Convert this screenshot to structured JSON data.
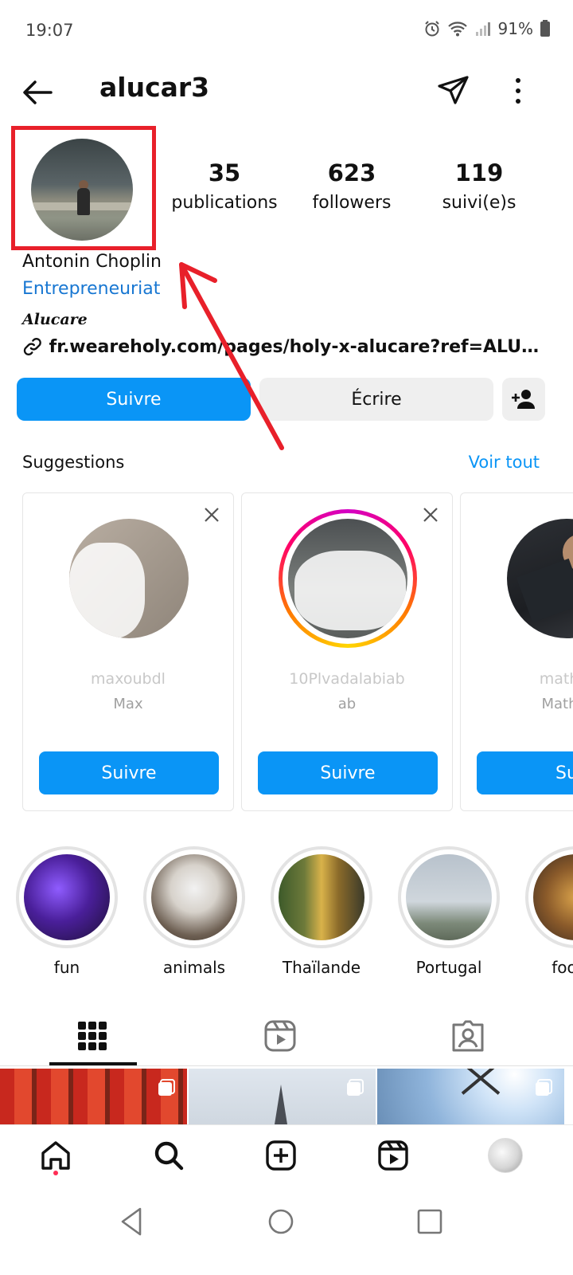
{
  "status_bar": {
    "time": "19:07",
    "battery": "91%"
  },
  "header": {
    "username": "alucar3"
  },
  "profile": {
    "stats": [
      {
        "value": "35",
        "label": "publications"
      },
      {
        "value": "623",
        "label": "followers"
      },
      {
        "value": "119",
        "label": "suivi(e)s"
      }
    ],
    "full_name": "Antonin Choplin",
    "category": "Entrepreneuriat",
    "bio": "Alucare",
    "link": "fr.weareholy.com/pages/holy-x-alucare?ref=ALUC..."
  },
  "actions": {
    "follow_label": "Suivre",
    "message_label": "Écrire"
  },
  "suggestions": {
    "title": "Suggestions",
    "see_all": "Voir tout",
    "cards": [
      {
        "handle": "maxoubdl",
        "name": "Max",
        "button": "Suivre"
      },
      {
        "handle": "10Plvadalabiab",
        "name": "ab",
        "button": "Suivre"
      },
      {
        "handle": "mathia",
        "name": "Mathia",
        "button": "Su"
      }
    ]
  },
  "highlights": [
    {
      "label": "fun"
    },
    {
      "label": "animals"
    },
    {
      "label": "Thaïlande"
    },
    {
      "label": "Portugal"
    },
    {
      "label": "food c"
    }
  ],
  "colors": {
    "accent": "#0a95f6",
    "highlight_box": "#e8202a",
    "annotation_arrow": "#e8202a"
  }
}
